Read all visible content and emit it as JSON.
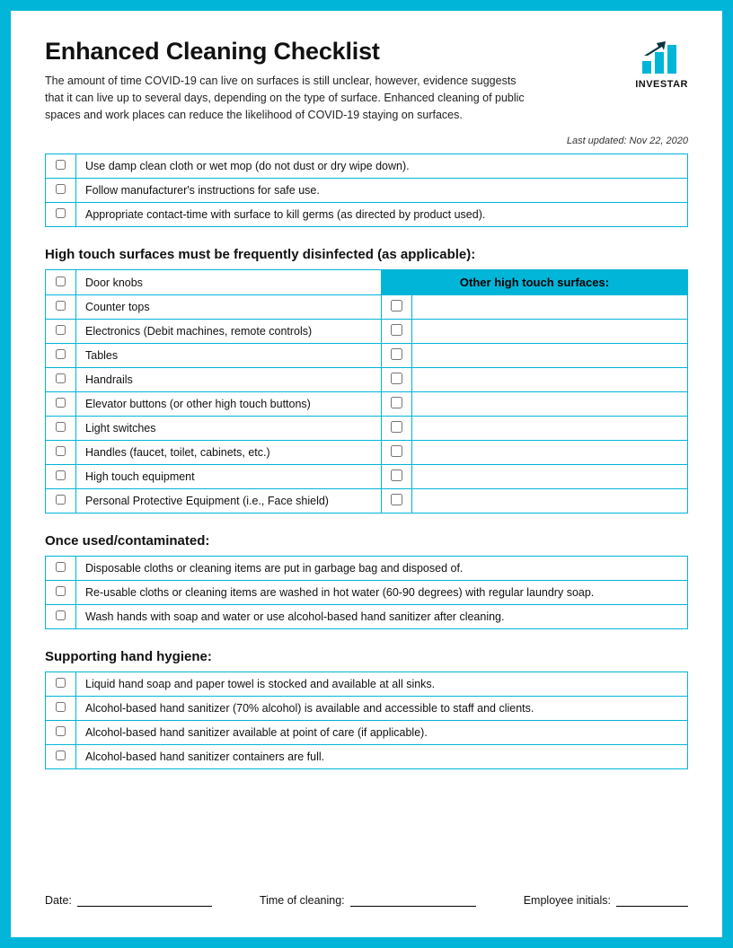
{
  "brand": {
    "name": "INVESTAR"
  },
  "title": "Enhanced Cleaning Checklist",
  "intro": "The amount of time COVID-19 can live on surfaces is still unclear, however, evidence suggests that it can live up to several days, depending on the type of surface. Enhanced cleaning of public spaces and work places can reduce the likelihood of COVID-19 staying on surfaces.",
  "last_updated": "Last updated: Nov 22, 2020",
  "sections": {
    "general": {
      "items": [
        "Use damp clean cloth or wet mop (do not dust or dry wipe down).",
        "Follow manufacturer's instructions for safe use.",
        "Appropriate contact-time with surface to kill germs (as directed by product used)."
      ]
    },
    "high_touch": {
      "title": "High touch surfaces must be frequently disinfected (as applicable):",
      "other_header": "Other high touch surfaces:",
      "items": [
        "Door knobs",
        "Counter tops",
        "Electronics (Debit machines, remote controls)",
        "Tables",
        "Handrails",
        "Elevator buttons (or other high touch buttons)",
        "Light switches",
        "Handles (faucet, toilet, cabinets, etc.)",
        "High touch equipment",
        "Personal Protective Equipment (i.e., Face shield)"
      ]
    },
    "once_used": {
      "title": "Once used/contaminated:",
      "items": [
        "Disposable cloths or cleaning items are put in garbage bag and disposed of.",
        "Re-usable cloths or cleaning items are washed in hot water (60-90 degrees) with regular laundry soap.",
        "Wash hands with soap and water or use alcohol-based hand sanitizer after cleaning."
      ]
    },
    "hand_hygiene": {
      "title": "Supporting hand hygiene:",
      "items": [
        "Liquid hand soap and paper towel is stocked and available at all sinks.",
        "Alcohol-based hand sanitizer (70% alcohol) is available and accessible to staff and clients.",
        "Alcohol-based hand sanitizer available at point of care (if applicable).",
        "Alcohol-based hand sanitizer containers are full."
      ]
    }
  },
  "footer": {
    "date_label": "Date:",
    "time_label": "Time of cleaning:",
    "initials_label": "Employee initials:"
  }
}
